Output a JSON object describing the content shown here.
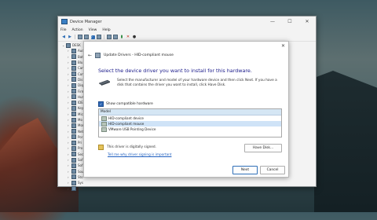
{
  "window": {
    "title": "Device Manager",
    "controls": [
      "—",
      "☐",
      "✕"
    ]
  },
  "menu": [
    "File",
    "Action",
    "View",
    "Help"
  ],
  "tree": {
    "root": "DESK",
    "items": [
      "Aud",
      "Bat",
      "Blu",
      "Cam",
      "Com",
      "Dis",
      "Disp",
      "Firm",
      "Hum",
      "IDE",
      "Key",
      "Mic",
      "Mo",
      "Mon",
      "Net",
      "Por",
      "Pri",
      "Pro",
      "Sec",
      "Sof",
      "Sof",
      "Sou",
      "Sto",
      "Sys",
      "Uni"
    ]
  },
  "dialog": {
    "close": "✕",
    "back": "←",
    "wizard_title": "Update Drivers - HID-compliant mouse",
    "heading": "Select the device driver you want to install for this hardware.",
    "instructions": "Select the manufacturer and model of your hardware device and then click Next. If you have a disk that contains the driver you want to install, click Have Disk.",
    "checkbox_check": "✓",
    "show_compatible": "Show compatible hardware",
    "model_header": "Model",
    "models": [
      "HID-compliant device",
      "HID-compliant mouse",
      "VMware USB Pointing Device"
    ],
    "selected_index": 1,
    "signed_text": "This driver is digitally signed.",
    "signing_link": "Tell me why driver signing is important",
    "have_disk": "Have Disk...",
    "next": "Next",
    "cancel": "Cancel"
  }
}
